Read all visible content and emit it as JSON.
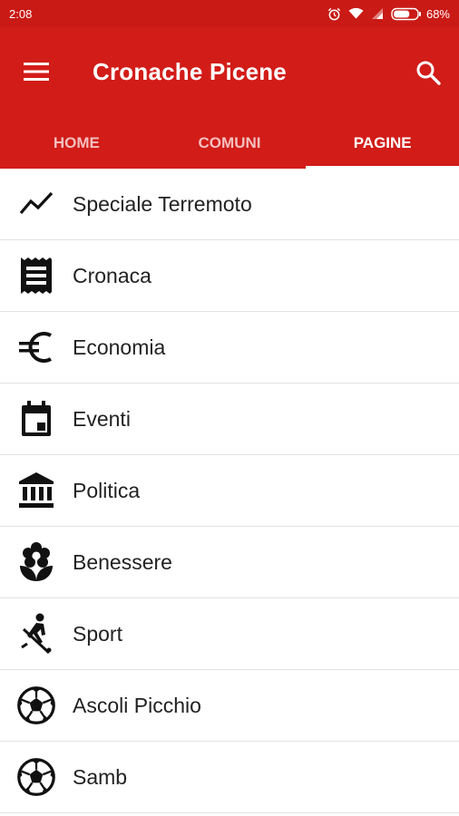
{
  "status": {
    "time": "2:08",
    "battery": "68%"
  },
  "appbar": {
    "title": "Cronache Picene"
  },
  "tabs": [
    {
      "label": "HOME",
      "active": false
    },
    {
      "label": "COMUNI",
      "active": false
    },
    {
      "label": "PAGINE",
      "active": true
    }
  ],
  "menu": [
    {
      "label": "Speciale Terremoto",
      "icon": "trending-icon"
    },
    {
      "label": "Cronaca",
      "icon": "receipt-icon"
    },
    {
      "label": "Economia",
      "icon": "euro-icon"
    },
    {
      "label": "Eventi",
      "icon": "calendar-icon"
    },
    {
      "label": "Politica",
      "icon": "bank-icon"
    },
    {
      "label": "Benessere",
      "icon": "flower-icon"
    },
    {
      "label": "Sport",
      "icon": "hockey-icon"
    },
    {
      "label": "Ascoli Picchio",
      "icon": "soccer-ball-icon"
    },
    {
      "label": "Samb",
      "icon": "soccer-ball-icon"
    }
  ],
  "colors": {
    "primary": "#d21c18",
    "statusbar": "#c91a16"
  }
}
